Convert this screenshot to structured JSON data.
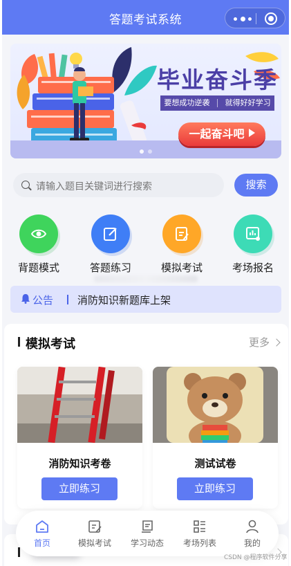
{
  "header": {
    "title": "答题考试系统"
  },
  "banner": {
    "headline": "毕业奋斗季",
    "tagline_left": "要想成功逆袭",
    "tagline_right": "就得好好学习",
    "cta": "一起奋斗吧"
  },
  "search": {
    "placeholder": "请输入题目关键词进行搜索",
    "button": "搜索"
  },
  "categories": [
    {
      "label": "背题模式",
      "icon": "eye-icon",
      "color": "#3fd45c"
    },
    {
      "label": "答题练习",
      "icon": "edit-icon",
      "color": "#3f7ef6"
    },
    {
      "label": "模拟考试",
      "icon": "exam-paper-icon",
      "color": "#ffa727"
    },
    {
      "label": "考场报名",
      "icon": "signup-board-icon",
      "color": "#3ddbb6"
    }
  ],
  "notice": {
    "tag": "公告",
    "message": "消防知识新题库上架"
  },
  "section": {
    "title": "模拟考试",
    "more": "更多",
    "cards": [
      {
        "name": "消防知识考卷",
        "button": "立即练习"
      },
      {
        "name": "测试试卷",
        "button": "立即练习"
      }
    ]
  },
  "tabbar": {
    "items": [
      {
        "label": "首页",
        "icon": "home-icon",
        "active": true
      },
      {
        "label": "模拟考试",
        "icon": "exam-icon",
        "active": false
      },
      {
        "label": "学习动态",
        "icon": "news-icon",
        "active": false
      },
      {
        "label": "考场列表",
        "icon": "list-icon",
        "active": false
      },
      {
        "label": "我的",
        "icon": "user-icon",
        "active": false
      }
    ]
  },
  "watermark": "CSDN @程序软件分享",
  "colors": {
    "primary": "#5e7af3",
    "notice_bg": "#dfe3fd",
    "cta_red": "#ea3b3b"
  }
}
